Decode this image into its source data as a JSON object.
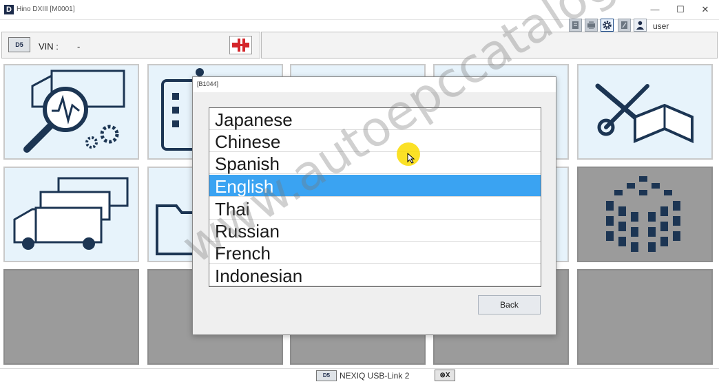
{
  "window": {
    "logo_letter": "D",
    "title": "Hino DXIII [M0001]",
    "minimize": "—",
    "maximize": "☐",
    "close": "✕"
  },
  "toolbar": {
    "user_label": "user",
    "icons": [
      "info-icon",
      "printer-icon",
      "gear-icon",
      "help-icon",
      "user-icon"
    ]
  },
  "vin_bar": {
    "device_badge": "D5",
    "vin_label": "VIN :",
    "vin_value": "-",
    "connect_icon": "connector-icon"
  },
  "dialog": {
    "title": "[B1044]",
    "languages": [
      "Japanese",
      "Chinese",
      "Spanish",
      "English",
      "Thai",
      "Russian",
      "French",
      "Indonesian"
    ],
    "selected": "English",
    "back_label": "Back"
  },
  "status_bar": {
    "device_badge": "D5",
    "device_label": "NEXIQ USB-Link 2",
    "disconnect_icon": "⊗X"
  },
  "watermark": "www.autoepccatalog.com",
  "colors": {
    "selection": "#3aa3f2",
    "tile_light": "#e7f3fb",
    "tile_gray": "#9b9b9b",
    "icon_navy": "#1c3553",
    "connector_red": "#d4262b"
  }
}
